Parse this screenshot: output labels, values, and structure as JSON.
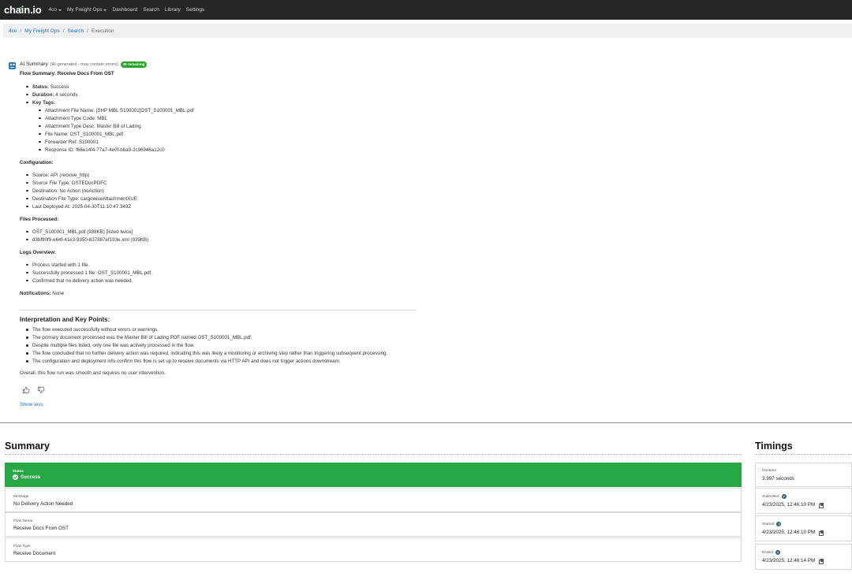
{
  "nav": {
    "logo": "chain.io",
    "links": [
      {
        "label": "4co",
        "caret": true
      },
      {
        "label": "My Freight Ops",
        "caret": true
      },
      {
        "label": "Dashboard"
      },
      {
        "label": "Search"
      },
      {
        "label": "Library"
      },
      {
        "label": "Settings"
      }
    ]
  },
  "breadcrumb": [
    "4co",
    "My Freight Ops",
    "Search",
    "Execution"
  ],
  "ai": {
    "title": "AI Summary",
    "note": "(AI-generated - may contain errors)",
    "badge": "49 remaining",
    "flow_summary": "Flow Summary: Receive Docs From OST",
    "status_label": "Status:",
    "status_value": "Success",
    "duration_label": "Duration:",
    "duration_value": "4 seconds",
    "key_tags_label": "Key Tags:",
    "key_tags": [
      "Attachment File Name: [SHP MBL S100001]OST_S100001_MBL.pdf",
      "Attachment Type Code: MBL",
      "Attachment Type Desc: Master Bill of Lading",
      "File Name: OST_S100001_MBL.pdf",
      "Forwarder Ref: S100001",
      "Response ID: f66e14f4-77a7-4e0f-bba9-2c96946a12c0"
    ],
    "config_label": "Configuration:",
    "config": [
      "Source: API (receive_http)",
      "Source File Type: OSTEDocPDFC",
      "Destination: No Action (noAction)",
      "Destination File Type: cargowiseAttachmentXUE",
      "Last Deployed At: 2025-04-30T11:10:47.349Z"
    ],
    "files_label": "Files Processed:",
    "files": [
      "OST_S100001_MBL.pdf (938KB) [listed twice]",
      "d3bf90f9-e64f-41e3-9350-637887ef193e.xml (939KB)"
    ],
    "logs_label": "Logs Overview:",
    "logs": [
      "Process started with 1 file.",
      "Successfully processed 1 file: OST_S100001_MBL.pdf.",
      "Confirmed that no delivery action was needed."
    ],
    "notifications_label": "Notifications:",
    "notifications_value": "None",
    "interp_heading": "Interpretation and Key Points:",
    "interp": [
      "The flow executed successfully without errors or warnings.",
      "The primary document processed was the Master Bill of Lading PDF named OST_S100001_MBL.pdf.",
      "Despite multiple files listed, only one file was actively processed in the flow.",
      "The flow concluded that no further delivery action was required, indicating this was likely a monitoring or archiving step rather than triggering subsequent processing.",
      "The configuration and deployment info confirm this flow is set up to receive documents via HTTP API and does not trigger actions downstream."
    ],
    "overall": "Overall, this flow run was smooth and requires no user intervention.",
    "show_less": "Show less"
  },
  "summary": {
    "title": "Summary",
    "status_label": "Status",
    "status_value": "Success",
    "status_color": "#28a745",
    "rows": [
      {
        "label": "Message",
        "value": "No Delivery Action Needed"
      },
      {
        "label": "Flow Name",
        "value": "Receive Docs From OST"
      },
      {
        "label": "Flow Type",
        "value": "Receive Document"
      }
    ]
  },
  "timings": {
    "title": "Timings",
    "duration_label": "Duration",
    "duration_value": "3.997 seconds",
    "submitted_label": "Submitted",
    "submitted_value": "4/23/2025, 12:46:10 PM",
    "started_label": "Started",
    "started_value": "4/23/2025, 12:46:10 PM",
    "ended_label": "Ended",
    "ended_value": "4/23/2025, 12:46:14 PM"
  }
}
